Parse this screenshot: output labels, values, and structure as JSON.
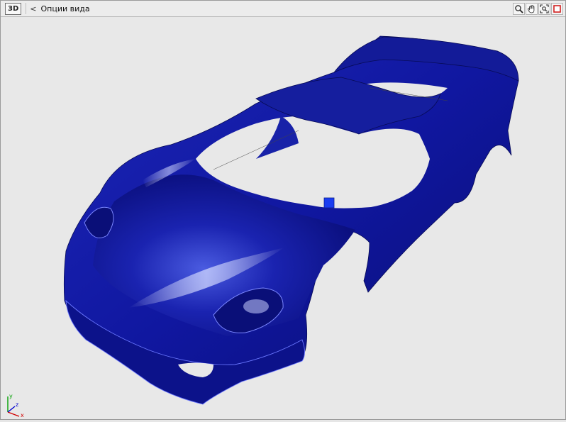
{
  "header": {
    "mode_badge": "3D",
    "back_glyph": "<",
    "title": "Опции вида"
  },
  "toolbar": {
    "tools": [
      {
        "icon": "zoom-icon"
      },
      {
        "icon": "pan-hand-icon"
      },
      {
        "icon": "zoom-extents-icon"
      },
      {
        "icon": "maximize-icon",
        "color": "#d02020"
      }
    ]
  },
  "viewport": {
    "model_color": "#0e1697",
    "axes": {
      "x": "x",
      "y": "y",
      "z": "z"
    }
  }
}
